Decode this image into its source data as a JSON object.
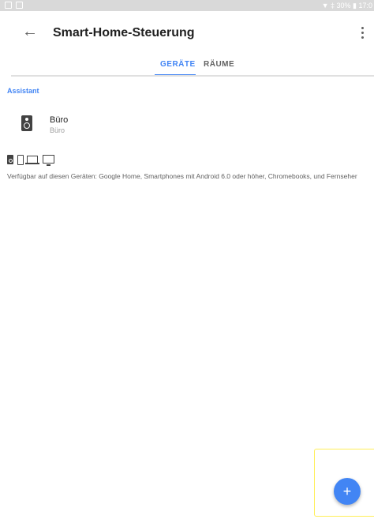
{
  "status_bar": {
    "right_text": "▼ ‡ 30% ▮ 17:0"
  },
  "app_bar": {
    "title": "Smart-Home-Steuerung"
  },
  "tabs": [
    {
      "label": "GERÄTE",
      "active": true
    },
    {
      "label": "RÄUME",
      "active": false
    }
  ],
  "section": {
    "header": "Assistant",
    "device": {
      "name": "Büro",
      "room": "Büro",
      "icon": "speaker-icon"
    }
  },
  "availability": {
    "icons": [
      "speaker-icon",
      "phone-icon",
      "laptop-icon",
      "tv-icon"
    ],
    "text": "Verfügbar auf diesen Geräten: Google Home, Smartphones mit Android 6.0 oder höher, Chromebooks, und Fernseher"
  },
  "fab": {
    "label": "+"
  },
  "colors": {
    "accent": "#4285f4",
    "highlight": "#ffee58"
  }
}
